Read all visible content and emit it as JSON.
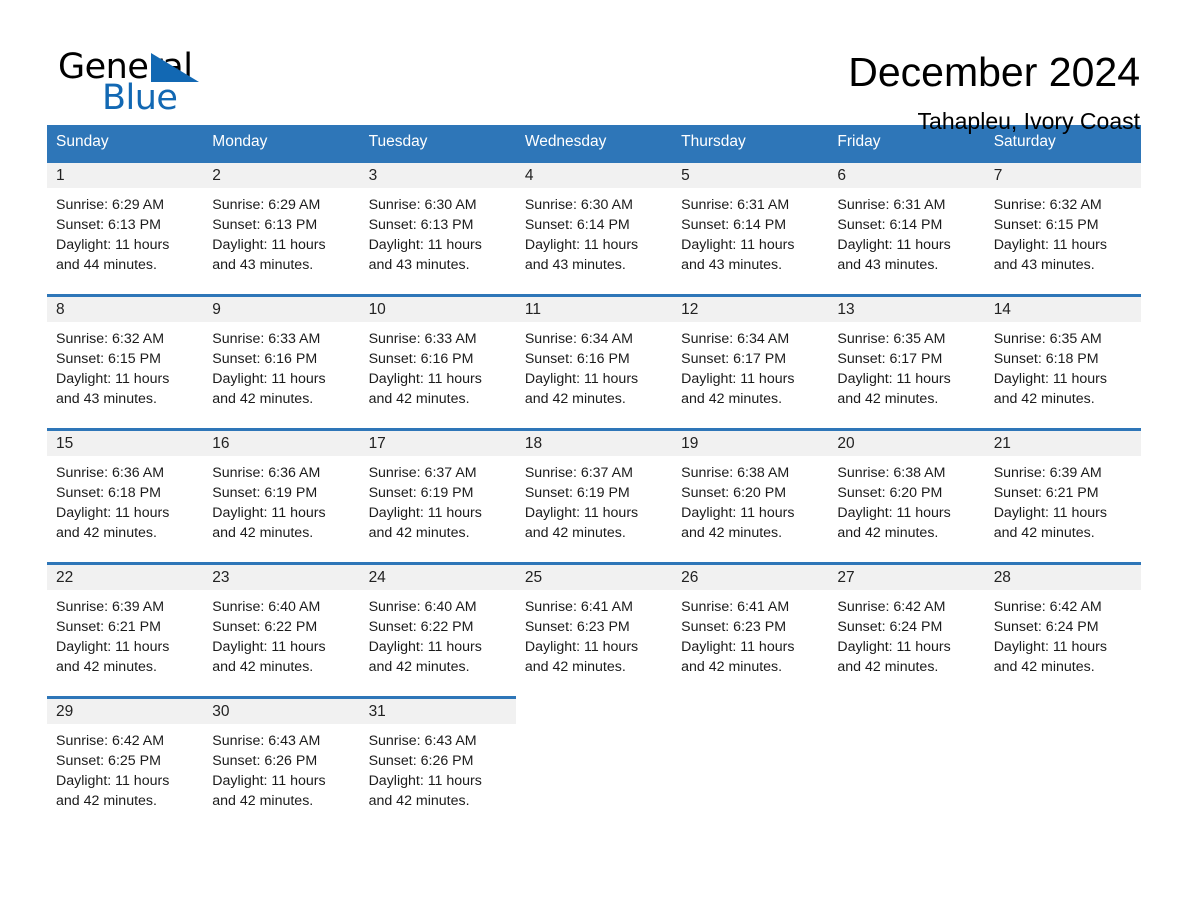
{
  "brand": {
    "name_part1": "General",
    "name_part2": "Blue",
    "flag_icon": "blue-triangle-flag-icon"
  },
  "header": {
    "title": "December 2024",
    "subtitle": "Tahapleu, Ivory Coast"
  },
  "colors": {
    "header_blue": "#2e76b8",
    "brand_blue": "#1268b3",
    "daynum_band": "#f1f1f1",
    "text": "#1b1b1b"
  },
  "weekday_headers": [
    "Sunday",
    "Monday",
    "Tuesday",
    "Wednesday",
    "Thursday",
    "Friday",
    "Saturday"
  ],
  "weeks": [
    [
      {
        "day": "1",
        "sunrise": "Sunrise: 6:29 AM",
        "sunset": "Sunset: 6:13 PM",
        "daylight_line1": "Daylight: 11 hours",
        "daylight_line2": "and 44 minutes."
      },
      {
        "day": "2",
        "sunrise": "Sunrise: 6:29 AM",
        "sunset": "Sunset: 6:13 PM",
        "daylight_line1": "Daylight: 11 hours",
        "daylight_line2": "and 43 minutes."
      },
      {
        "day": "3",
        "sunrise": "Sunrise: 6:30 AM",
        "sunset": "Sunset: 6:13 PM",
        "daylight_line1": "Daylight: 11 hours",
        "daylight_line2": "and 43 minutes."
      },
      {
        "day": "4",
        "sunrise": "Sunrise: 6:30 AM",
        "sunset": "Sunset: 6:14 PM",
        "daylight_line1": "Daylight: 11 hours",
        "daylight_line2": "and 43 minutes."
      },
      {
        "day": "5",
        "sunrise": "Sunrise: 6:31 AM",
        "sunset": "Sunset: 6:14 PM",
        "daylight_line1": "Daylight: 11 hours",
        "daylight_line2": "and 43 minutes."
      },
      {
        "day": "6",
        "sunrise": "Sunrise: 6:31 AM",
        "sunset": "Sunset: 6:14 PM",
        "daylight_line1": "Daylight: 11 hours",
        "daylight_line2": "and 43 minutes."
      },
      {
        "day": "7",
        "sunrise": "Sunrise: 6:32 AM",
        "sunset": "Sunset: 6:15 PM",
        "daylight_line1": "Daylight: 11 hours",
        "daylight_line2": "and 43 minutes."
      }
    ],
    [
      {
        "day": "8",
        "sunrise": "Sunrise: 6:32 AM",
        "sunset": "Sunset: 6:15 PM",
        "daylight_line1": "Daylight: 11 hours",
        "daylight_line2": "and 43 minutes."
      },
      {
        "day": "9",
        "sunrise": "Sunrise: 6:33 AM",
        "sunset": "Sunset: 6:16 PM",
        "daylight_line1": "Daylight: 11 hours",
        "daylight_line2": "and 42 minutes."
      },
      {
        "day": "10",
        "sunrise": "Sunrise: 6:33 AM",
        "sunset": "Sunset: 6:16 PM",
        "daylight_line1": "Daylight: 11 hours",
        "daylight_line2": "and 42 minutes."
      },
      {
        "day": "11",
        "sunrise": "Sunrise: 6:34 AM",
        "sunset": "Sunset: 6:16 PM",
        "daylight_line1": "Daylight: 11 hours",
        "daylight_line2": "and 42 minutes."
      },
      {
        "day": "12",
        "sunrise": "Sunrise: 6:34 AM",
        "sunset": "Sunset: 6:17 PM",
        "daylight_line1": "Daylight: 11 hours",
        "daylight_line2": "and 42 minutes."
      },
      {
        "day": "13",
        "sunrise": "Sunrise: 6:35 AM",
        "sunset": "Sunset: 6:17 PM",
        "daylight_line1": "Daylight: 11 hours",
        "daylight_line2": "and 42 minutes."
      },
      {
        "day": "14",
        "sunrise": "Sunrise: 6:35 AM",
        "sunset": "Sunset: 6:18 PM",
        "daylight_line1": "Daylight: 11 hours",
        "daylight_line2": "and 42 minutes."
      }
    ],
    [
      {
        "day": "15",
        "sunrise": "Sunrise: 6:36 AM",
        "sunset": "Sunset: 6:18 PM",
        "daylight_line1": "Daylight: 11 hours",
        "daylight_line2": "and 42 minutes."
      },
      {
        "day": "16",
        "sunrise": "Sunrise: 6:36 AM",
        "sunset": "Sunset: 6:19 PM",
        "daylight_line1": "Daylight: 11 hours",
        "daylight_line2": "and 42 minutes."
      },
      {
        "day": "17",
        "sunrise": "Sunrise: 6:37 AM",
        "sunset": "Sunset: 6:19 PM",
        "daylight_line1": "Daylight: 11 hours",
        "daylight_line2": "and 42 minutes."
      },
      {
        "day": "18",
        "sunrise": "Sunrise: 6:37 AM",
        "sunset": "Sunset: 6:19 PM",
        "daylight_line1": "Daylight: 11 hours",
        "daylight_line2": "and 42 minutes."
      },
      {
        "day": "19",
        "sunrise": "Sunrise: 6:38 AM",
        "sunset": "Sunset: 6:20 PM",
        "daylight_line1": "Daylight: 11 hours",
        "daylight_line2": "and 42 minutes."
      },
      {
        "day": "20",
        "sunrise": "Sunrise: 6:38 AM",
        "sunset": "Sunset: 6:20 PM",
        "daylight_line1": "Daylight: 11 hours",
        "daylight_line2": "and 42 minutes."
      },
      {
        "day": "21",
        "sunrise": "Sunrise: 6:39 AM",
        "sunset": "Sunset: 6:21 PM",
        "daylight_line1": "Daylight: 11 hours",
        "daylight_line2": "and 42 minutes."
      }
    ],
    [
      {
        "day": "22",
        "sunrise": "Sunrise: 6:39 AM",
        "sunset": "Sunset: 6:21 PM",
        "daylight_line1": "Daylight: 11 hours",
        "daylight_line2": "and 42 minutes."
      },
      {
        "day": "23",
        "sunrise": "Sunrise: 6:40 AM",
        "sunset": "Sunset: 6:22 PM",
        "daylight_line1": "Daylight: 11 hours",
        "daylight_line2": "and 42 minutes."
      },
      {
        "day": "24",
        "sunrise": "Sunrise: 6:40 AM",
        "sunset": "Sunset: 6:22 PM",
        "daylight_line1": "Daylight: 11 hours",
        "daylight_line2": "and 42 minutes."
      },
      {
        "day": "25",
        "sunrise": "Sunrise: 6:41 AM",
        "sunset": "Sunset: 6:23 PM",
        "daylight_line1": "Daylight: 11 hours",
        "daylight_line2": "and 42 minutes."
      },
      {
        "day": "26",
        "sunrise": "Sunrise: 6:41 AM",
        "sunset": "Sunset: 6:23 PM",
        "daylight_line1": "Daylight: 11 hours",
        "daylight_line2": "and 42 minutes."
      },
      {
        "day": "27",
        "sunrise": "Sunrise: 6:42 AM",
        "sunset": "Sunset: 6:24 PM",
        "daylight_line1": "Daylight: 11 hours",
        "daylight_line2": "and 42 minutes."
      },
      {
        "day": "28",
        "sunrise": "Sunrise: 6:42 AM",
        "sunset": "Sunset: 6:24 PM",
        "daylight_line1": "Daylight: 11 hours",
        "daylight_line2": "and 42 minutes."
      }
    ],
    [
      {
        "day": "29",
        "sunrise": "Sunrise: 6:42 AM",
        "sunset": "Sunset: 6:25 PM",
        "daylight_line1": "Daylight: 11 hours",
        "daylight_line2": "and 42 minutes."
      },
      {
        "day": "30",
        "sunrise": "Sunrise: 6:43 AM",
        "sunset": "Sunset: 6:26 PM",
        "daylight_line1": "Daylight: 11 hours",
        "daylight_line2": "and 42 minutes."
      },
      {
        "day": "31",
        "sunrise": "Sunrise: 6:43 AM",
        "sunset": "Sunset: 6:26 PM",
        "daylight_line1": "Daylight: 11 hours",
        "daylight_line2": "and 42 minutes."
      },
      null,
      null,
      null,
      null
    ]
  ]
}
